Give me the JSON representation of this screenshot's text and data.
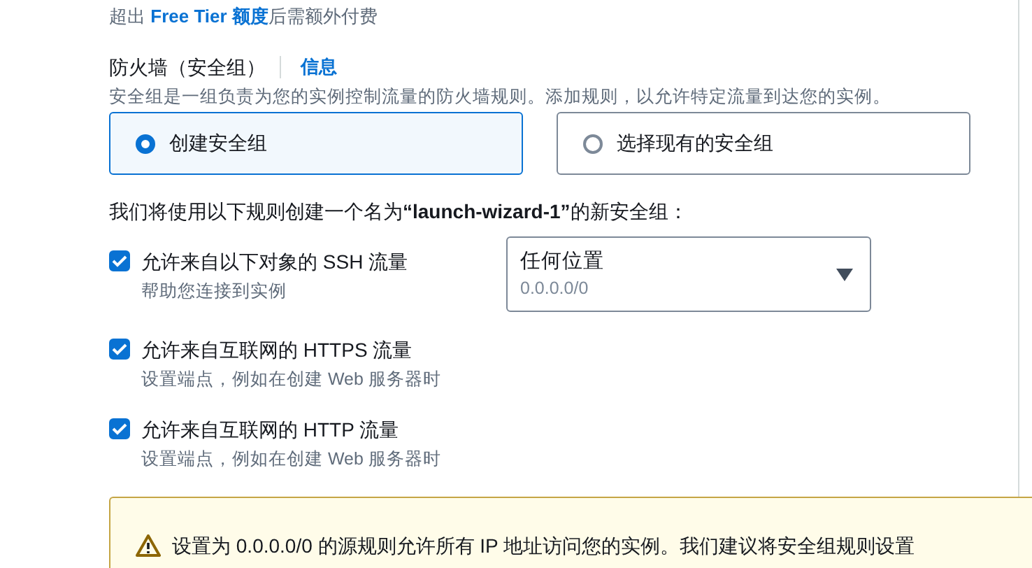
{
  "cost_note": {
    "before": "超出 ",
    "link": "Free Tier 额度",
    "after": "后需额外付费"
  },
  "firewall": {
    "title": "防火墙（安全组）",
    "info_link": "信息",
    "description": "安全组是一组负责为您的实例控制流量的防火墙规则。添加规则，以允许特定流量到达您的实例。"
  },
  "group_options": [
    {
      "label": "创建安全组",
      "selected": true
    },
    {
      "label": "选择现有的安全组",
      "selected": false
    }
  ],
  "rules_intro": "我们将使用以下规则创建一个名为**“launch-wizard-1”**的新安全组：",
  "rules": [
    {
      "label": "允许来自以下对象的 SSH 流量",
      "hint": "帮助您连接到实例",
      "checked": true,
      "source": {
        "value": "任何位置",
        "detail": "0.0.0.0/0"
      }
    },
    {
      "label": "允许来自互联网的 HTTPS 流量",
      "hint": "设置端点，例如在创建 Web 服务器时",
      "checked": true
    },
    {
      "label": "允许来自互联网的 HTTP 流量",
      "hint": "设置端点，例如在创建 Web 服务器时",
      "checked": true
    }
  ],
  "warning": {
    "text": "设置为 0.0.0.0/0 的源规则允许所有 IP 地址访问您的实例。我们建议将安全组规则设置"
  }
}
